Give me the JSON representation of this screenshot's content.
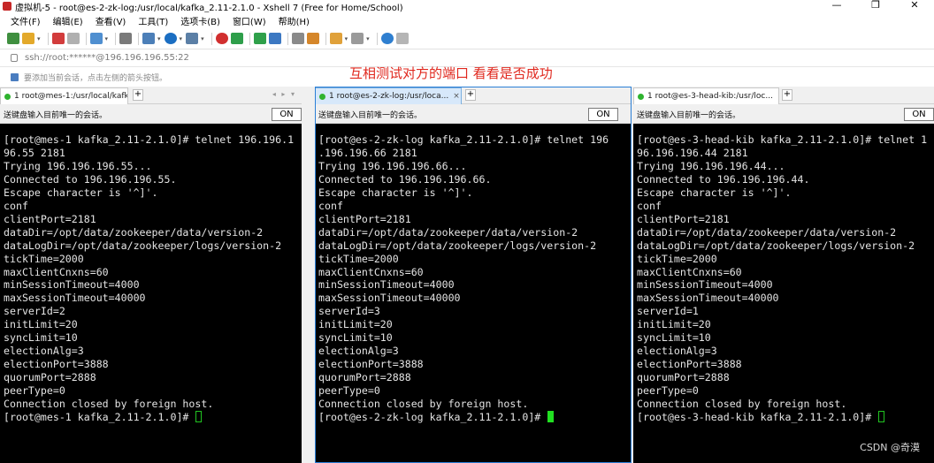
{
  "window": {
    "title": "虚拟机-5 - root@es-2-zk-log:/usr/local/kafka_2.11-2.1.0 - Xshell 7 (Free for Home/School)",
    "minimize": "—",
    "maximize": "❐",
    "close": "✕"
  },
  "menu": [
    "文件(F)",
    "编辑(E)",
    "查看(V)",
    "工具(T)",
    "选项卡(B)",
    "窗口(W)",
    "帮助(H)"
  ],
  "address": "ssh://root:******@196.196.196.55:22",
  "hint": "要添加当前会话，点击左侧的箭头按钮。",
  "annotation": "互相测试对方的端口 看看是否成功",
  "send_label": "送键盘输入目前唯一的会话。",
  "send_button": "ON",
  "tab_add": "+",
  "tab_close": "×",
  "tab_nav": "◂ ▸ ▾",
  "panes": [
    {
      "tab": "1 root@mes-1:/usr/local/kafk...",
      "lines": "[root@mes-1 kafka_2.11-2.1.0]# telnet 196.196.1\n96.55 2181\nTrying 196.196.196.55...\nConnected to 196.196.196.55.\nEscape character is '^]'.\nconf\nclientPort=2181\ndataDir=/opt/data/zookeeper/data/version-2\ndataLogDir=/opt/data/zookeeper/logs/version-2\ntickTime=2000\nmaxClientCnxns=60\nminSessionTimeout=4000\nmaxSessionTimeout=40000\nserverId=2\ninitLimit=20\nsyncLimit=10\nelectionAlg=3\nelectionPort=3888\nquorumPort=2888\npeerType=0\nConnection closed by foreign host.",
      "prompt": "[root@mes-1 kafka_2.11-2.1.0]# "
    },
    {
      "tab": "1 root@es-2-zk-log:/usr/loca...",
      "lines": "[root@es-2-zk-log kafka_2.11-2.1.0]# telnet 196\n.196.196.66 2181\nTrying 196.196.196.66...\nConnected to 196.196.196.66.\nEscape character is '^]'.\nconf\nclientPort=2181\ndataDir=/opt/data/zookeeper/data/version-2\ndataLogDir=/opt/data/zookeeper/logs/version-2\ntickTime=2000\nmaxClientCnxns=60\nminSessionTimeout=4000\nmaxSessionTimeout=40000\nserverId=3\ninitLimit=20\nsyncLimit=10\nelectionAlg=3\nelectionPort=3888\nquorumPort=2888\npeerType=0\nConnection closed by foreign host.",
      "prompt": "[root@es-2-zk-log kafka_2.11-2.1.0]# "
    },
    {
      "tab": "1 root@es-3-head-kib:/usr/loc...",
      "lines": "[root@es-3-head-kib kafka_2.11-2.1.0]# telnet 1\n96.196.196.44 2181\nTrying 196.196.196.44...\nConnected to 196.196.196.44.\nEscape character is '^]'.\nconf\nclientPort=2181\ndataDir=/opt/data/zookeeper/data/version-2\ndataLogDir=/opt/data/zookeeper/logs/version-2\ntickTime=2000\nmaxClientCnxns=60\nminSessionTimeout=4000\nmaxSessionTimeout=40000\nserverId=1\ninitLimit=20\nsyncLimit=10\nelectionAlg=3\nelectionPort=3888\nquorumPort=2888\npeerType=0\nConnection closed by foreign host.",
      "prompt": "[root@es-3-head-kib kafka_2.11-2.1.0]# "
    }
  ],
  "watermark": "CSDN @奇漠",
  "colors": {
    "cursor": "#21e021",
    "active_border": "#2b7fd6",
    "annotation": "#e0281e"
  }
}
